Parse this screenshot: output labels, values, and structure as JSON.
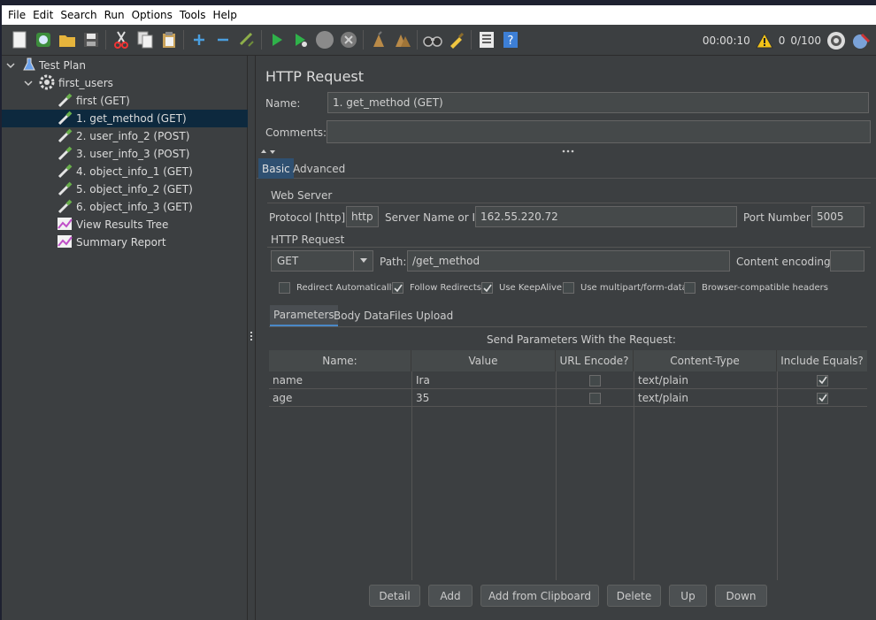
{
  "menubar": {
    "items": [
      "File",
      "Edit",
      "Search",
      "Run",
      "Options",
      "Tools",
      "Help"
    ]
  },
  "toolbar": {
    "icons": [
      "new-icon",
      "templates-icon",
      "open-icon",
      "save-icon",
      "cut-icon",
      "copy-icon",
      "paste-icon",
      "expand-icon",
      "collapse-icon",
      "toggle-icon",
      "start-icon",
      "start-no-pause-icon",
      "stop-icon",
      "shutdown-icon",
      "clear-icon",
      "clear-all-icon",
      "search-icon",
      "reset-search-icon",
      "function-helper-icon",
      "help-icon"
    ],
    "timer": "00:00:10",
    "warning_count": "0",
    "threads": "0/100"
  },
  "tree": {
    "root": "Test Plan",
    "group": "first_users",
    "items": [
      "first (GET)",
      "1. get_method (GET)",
      "2. user_info_2 (POST)",
      "3. user_info_3 (POST)",
      "4. object_info_1 (GET)",
      "5. object_info_2 (GET)",
      "6. object_info_3 (GET)",
      "View Results Tree",
      "Summary Report"
    ],
    "selected_index": 1
  },
  "panel": {
    "title": "HTTP Request",
    "name_label": "Name:",
    "name_value": "1. get_method (GET)",
    "comments_label": "Comments:",
    "comments_value": "",
    "tabs": [
      "Basic",
      "Advanced"
    ],
    "active_tab": "Basic",
    "web_server": {
      "group_title": "Web Server",
      "protocol_label": "Protocol [http]:",
      "protocol_value": "http",
      "server_label": "Server Name or IP:",
      "server_value": "162.55.220.72",
      "port_label": "Port Number:",
      "port_value": "5005"
    },
    "http_request": {
      "group_title": "HTTP Request",
      "method": "GET",
      "path_label": "Path:",
      "path_value": "/get_method",
      "encoding_label": "Content encoding:",
      "encoding_value": ""
    },
    "options": [
      {
        "label": "Redirect Automatically",
        "checked": false
      },
      {
        "label": "Follow Redirects",
        "checked": true
      },
      {
        "label": "Use KeepAlive",
        "checked": true
      },
      {
        "label": "Use multipart/form-data",
        "checked": false
      },
      {
        "label": "Browser-compatible headers",
        "checked": false
      }
    ],
    "subtabs": [
      "Parameters",
      "Body Data",
      "Files Upload"
    ],
    "active_subtab": "Parameters",
    "params_caption": "Send Parameters With the Request:",
    "columns": [
      "Name:",
      "Value",
      "URL Encode?",
      "Content-Type",
      "Include Equals?"
    ],
    "rows": [
      {
        "name": "name",
        "value": "Ira",
        "url_encode": false,
        "content_type": "text/plain",
        "include_equals": true
      },
      {
        "name": "age",
        "value": "35",
        "url_encode": false,
        "content_type": "text/plain",
        "include_equals": true
      }
    ],
    "buttons": [
      "Detail",
      "Add",
      "Add from Clipboard",
      "Delete",
      "Up",
      "Down"
    ]
  }
}
